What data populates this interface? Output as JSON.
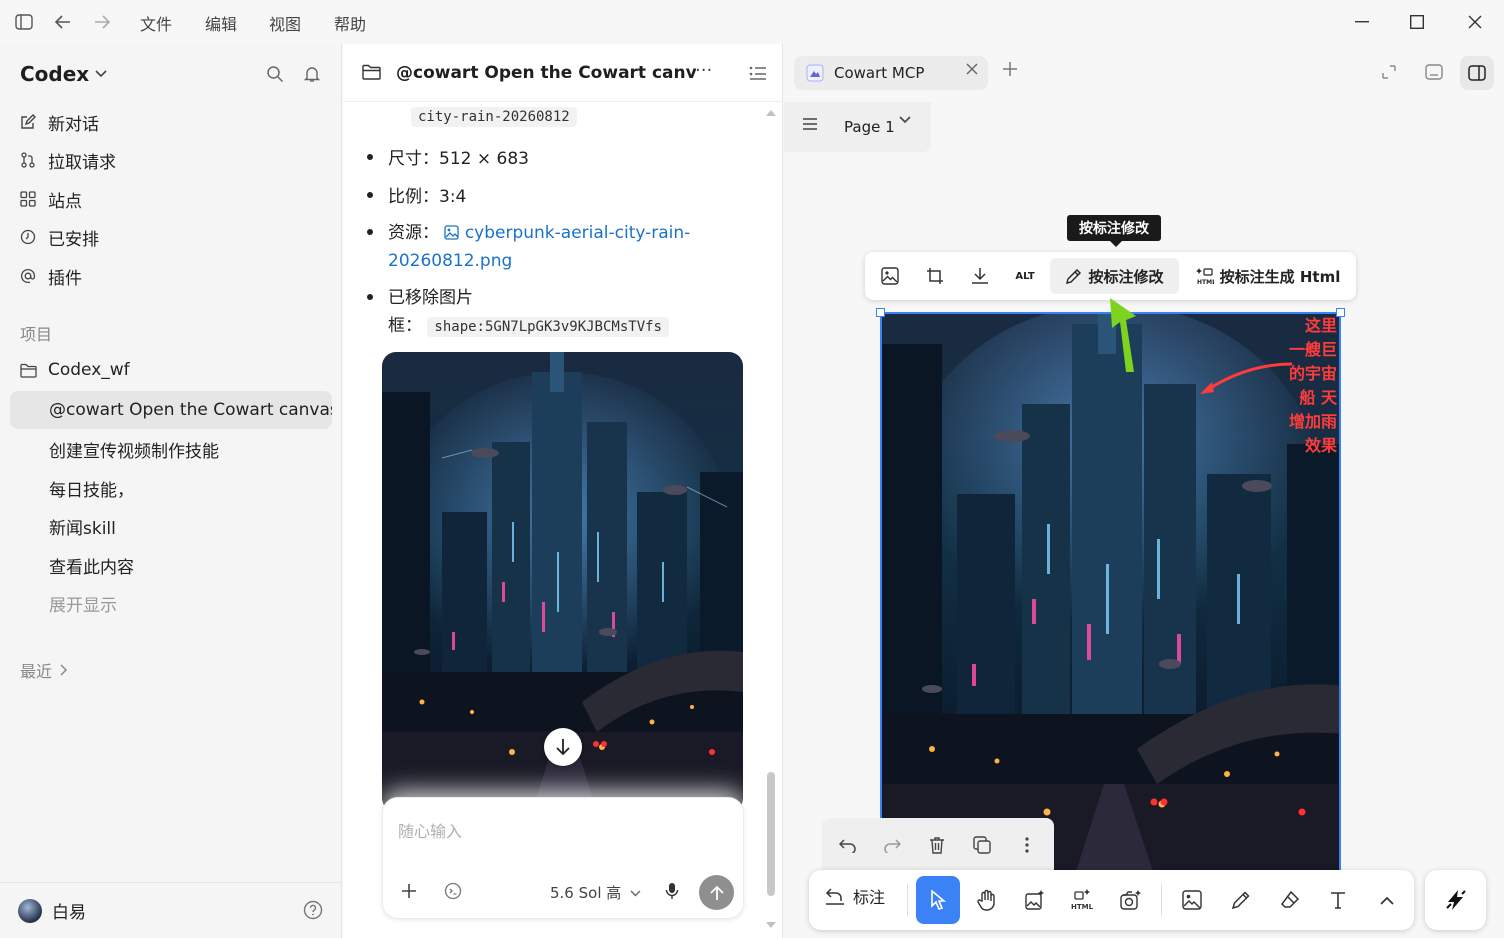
{
  "titlebar": {
    "menus": [
      "文件",
      "编辑",
      "视图",
      "帮助"
    ]
  },
  "sidebar": {
    "brand": "Codex",
    "nav": [
      {
        "label": "新对话",
        "icon": "edit-icon"
      },
      {
        "label": "拉取请求",
        "icon": "pull-request-icon"
      },
      {
        "label": "站点",
        "icon": "grid-icon"
      },
      {
        "label": "已安排",
        "icon": "clock-icon"
      },
      {
        "label": "插件",
        "icon": "at-icon"
      }
    ],
    "projects_header": "项目",
    "project_folder": "Codex_wf",
    "threads": [
      {
        "label": "@cowart Open the Cowart canvas f",
        "active": true
      },
      {
        "label": "创建宣传视频制作技能",
        "active": false
      },
      {
        "label": "每日技能，",
        "active": false
      },
      {
        "label": "新闻skill",
        "active": false
      },
      {
        "label": "查看此内容",
        "active": false
      }
    ],
    "expand": "展开显示",
    "recent": "最近",
    "user": "白易"
  },
  "chat": {
    "title": "@cowart Open the Cowart canvas fo",
    "name_code": "city-rain-20260812",
    "size_label": "尺寸：",
    "size_value": "512 × 683",
    "ratio_label": "比例：",
    "ratio_value": "3:4",
    "resource_label": "资源：",
    "resource_link_1": "cyberpunk-aerial-city-rain-",
    "resource_link_2": "20260812.png",
    "removed_label_1": "已移除图片",
    "removed_label_2": "框：",
    "shape_code": "shape:5GN7LpGK3v9KJBCMsTVfs",
    "composer_placeholder": "随心输入",
    "model": "5.6 Sol 高"
  },
  "canvas": {
    "tab_label": "Cowart MCP",
    "page_label": "Page 1",
    "tooltip": "按标注修改",
    "toolbar": {
      "alt": "ALT",
      "edit_by_annotation": "按标注修改",
      "gen_html": "按标注生成 Html"
    },
    "overlay_lines": [
      "这里",
      "一艘巨",
      "的宇宙",
      "船 天",
      "增加雨",
      "效果"
    ],
    "main_toolbar": {
      "annotate": "标注"
    }
  },
  "colors": {
    "accent": "#3b82f6",
    "link": "#1a73c8",
    "annotation_red": "#ff3b3b",
    "arrow_green": "#7ed321"
  }
}
